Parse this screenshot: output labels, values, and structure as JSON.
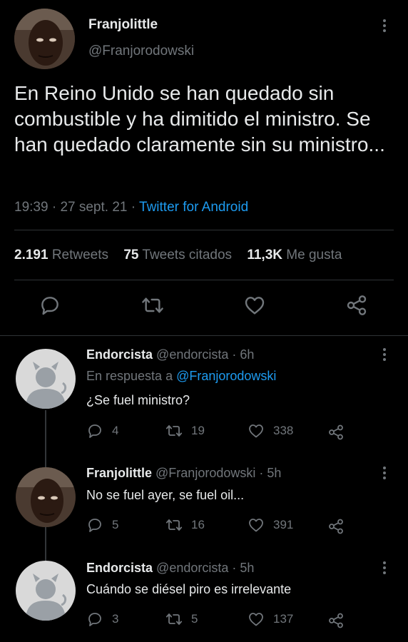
{
  "main_tweet": {
    "author_name": "Franjolittle",
    "author_handle": "@Franjorodowski",
    "text": "En Reino Unido se han quedado sin combustible y ha dimitido el ministro. Se han quedado claramente sin su ministro...",
    "time": "19:39",
    "date": "27 sept. 21",
    "source": "Twitter for Android",
    "retweets_count": "2.191",
    "retweets_label": "Retweets",
    "quotes_count": "75",
    "quotes_label": "Tweets citados",
    "likes_count": "11,3K",
    "likes_label": "Me gusta"
  },
  "replies": [
    {
      "author_name": "Endorcista",
      "author_handle": "@endorcista",
      "age": "6h",
      "reply_to_prefix": "En respuesta a",
      "reply_to_handle": "@Franjorodowski",
      "text": "¿Se fuel ministro?",
      "replies": "4",
      "retweets": "19",
      "likes": "338"
    },
    {
      "author_name": "Franjolittle",
      "author_handle": "@Franjorodowski",
      "age": "5h",
      "text": "No se fuel ayer, se fuel oil...",
      "replies": "5",
      "retweets": "16",
      "likes": "391"
    },
    {
      "author_name": "Endorcista",
      "author_handle": "@endorcista",
      "age": "5h",
      "text": "Cuándo se diésel piro es irrelevante",
      "replies": "3",
      "retweets": "5",
      "likes": "137"
    }
  ],
  "separator": "·",
  "colors": {
    "background": "#000000",
    "text": "#e7e9ea",
    "muted": "#71767b",
    "link": "#1d9bf0",
    "divider": "#2f3336"
  },
  "icons": [
    "reply-icon",
    "retweet-icon",
    "like-icon",
    "share-icon",
    "more-icon"
  ]
}
